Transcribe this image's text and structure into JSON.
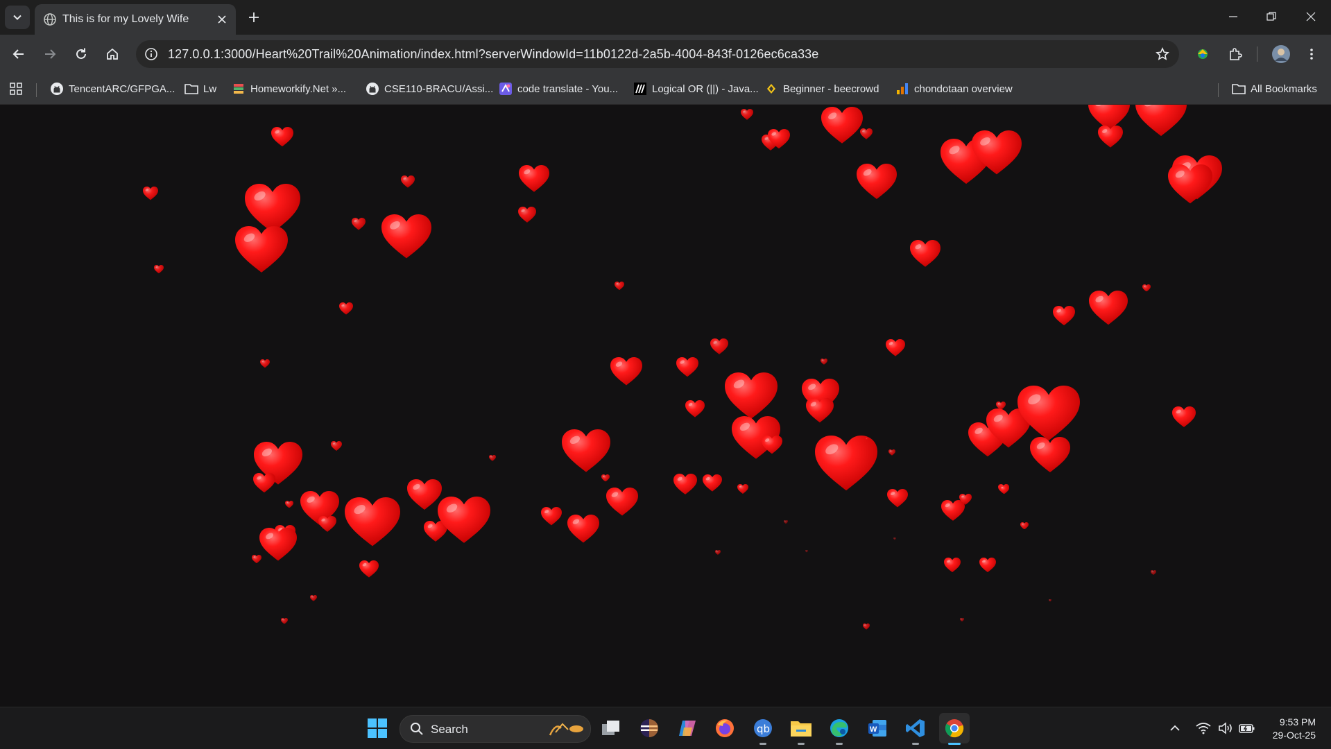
{
  "window": {
    "tab_title": "This is for my Lovely Wife",
    "colors": {
      "tabstrip": "#1f1f1f",
      "toolbar": "#353638",
      "page_bg": "#121112",
      "heart": "#ff1a1a"
    }
  },
  "toolbar": {
    "url": "127.0.0.1:3000/Heart%20Trail%20Animation/index.html?serverWindowId=11b0122d-2a5b-4004-843f-0126ec6ca33e"
  },
  "bookmarks": {
    "items": [
      {
        "label": "TencentARC/GFPGA...",
        "icon": "github-icon"
      },
      {
        "label": "Lw",
        "icon": "folder-icon"
      },
      {
        "label": "Homeworkify.Net »...",
        "icon": "books-icon"
      },
      {
        "label": "CSE110-BRACU/Assi...",
        "icon": "github-icon"
      },
      {
        "label": "code translate - You...",
        "icon": "translate-icon"
      },
      {
        "label": "Logical OR (||) - Java...",
        "icon": "mdn-icon"
      },
      {
        "label": "Beginner - beecrowd",
        "icon": "beecrowd-icon"
      },
      {
        "label": "chondotaan overview",
        "icon": "analytics-icon"
      }
    ],
    "all_bookmarks": "All Bookmarks"
  },
  "taskbar": {
    "search_label": "Search",
    "apps": [
      "windows-start-icon",
      "task-view-icon",
      "eclipse-icon",
      "copilot-icon",
      "firefox-icon",
      "qbittorrent-icon",
      "file-explorer-icon",
      "edge-icon",
      "word-icon",
      "vscode-icon",
      "chrome-icon"
    ],
    "time": "9:53 PM",
    "date": "29-Oct-25"
  }
}
